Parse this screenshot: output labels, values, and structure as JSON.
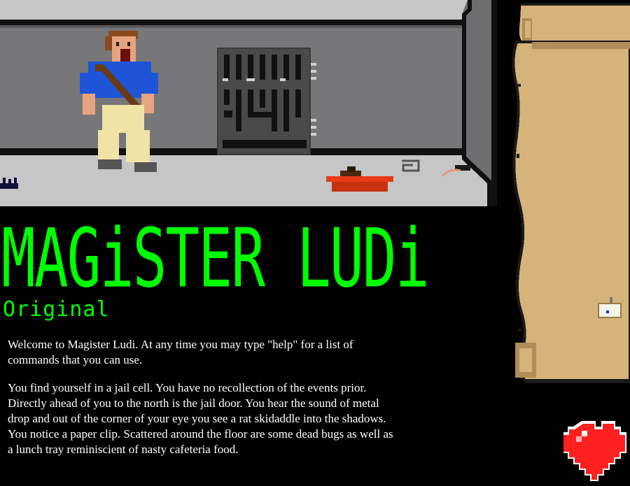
{
  "game": {
    "title": "MAGiSTER LUDi",
    "subtitle": "Original",
    "paragraphs": [
      "Welcome to Magister Ludi. At any time you may type \"help\" for a list of commands that you can use.",
      "You find yourself in a jail cell. You have no recollection of the events prior. Directly ahead of you to the north is the jail door. You hear the sound of metal drop and out of the corner of your eye you see a rat skidaddle into the shadows. You notice a paper clip. Scattered around the floor are some dead bugs as well as a lunch tray reminiscient of nasty cafeteria food."
    ]
  },
  "colors": {
    "title_green": "#00ff00",
    "background": "#000000",
    "parchment": "#d6b37a",
    "wall": "#7a7a7d",
    "floor": "#c6c6c6",
    "heart": "#ff2020"
  },
  "scene_items": {
    "character": "prisoner",
    "door": "jail-door",
    "tray": "lunch-tray",
    "clip": "paper-clip",
    "rat": "rat",
    "bugs": "dead-bugs"
  },
  "map": {
    "marker": "player-location-marker"
  },
  "health": {
    "icon": "heart-icon"
  }
}
